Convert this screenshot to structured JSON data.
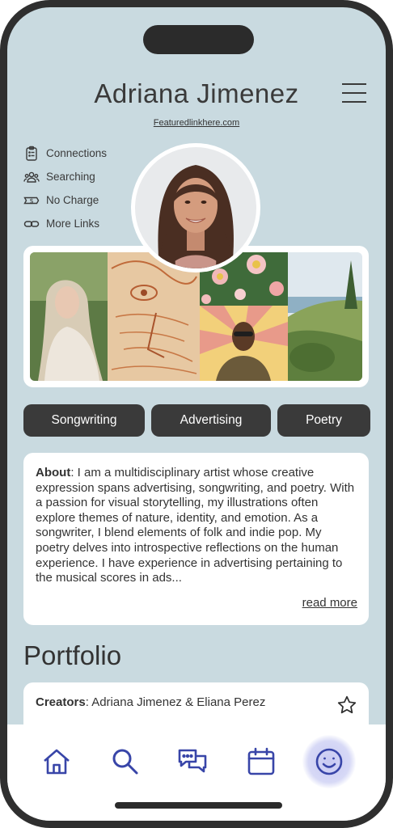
{
  "profile": {
    "name": "Adriana Jimenez",
    "featured_link": "Featuredlinkhere.com"
  },
  "quick_links": [
    {
      "label": "Connections",
      "icon": "clipboard-icon"
    },
    {
      "label": "Searching",
      "icon": "users-icon"
    },
    {
      "label": "No Charge",
      "icon": "money-icon"
    },
    {
      "label": "More Links",
      "icon": "link-icon"
    }
  ],
  "tags": [
    "Songwriting",
    "Advertising",
    "Poetry"
  ],
  "about": {
    "label": "About",
    "text": ": I am a multidisciplinary artist whose creative expression spans advertising, songwriting, and poetry. With a passion for visual storytelling, my illustrations often explore themes of nature, identity, and emotion. As a songwriter, I blend elements of folk and indie pop. My poetry delves into introspective reflections on the human experience. I have experience in advertising pertaining to the musical scores in ads...",
    "read_more": "read more"
  },
  "portfolio": {
    "title": "Portfolio",
    "creators_label": "Creators",
    "creators_value": ": Adriana Jimenez & Eliana Perez"
  },
  "nav": [
    {
      "name": "home-icon"
    },
    {
      "name": "search-icon"
    },
    {
      "name": "chat-icon"
    },
    {
      "name": "calendar-icon"
    },
    {
      "name": "smiley-icon",
      "active": true
    }
  ],
  "colors": {
    "background": "#c9dae0",
    "tag_bg": "#3a3a3a",
    "nav_icon": "#3845a8",
    "nav_active_glow": "#c7c9f2"
  }
}
